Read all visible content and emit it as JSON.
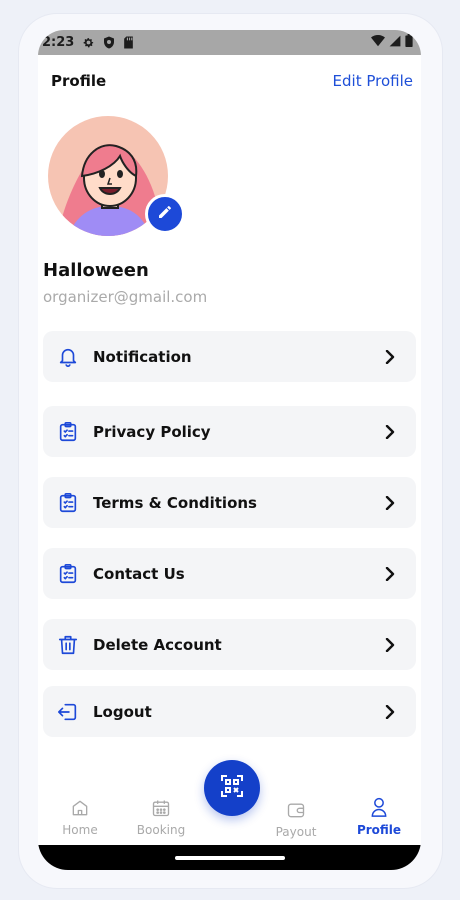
{
  "status_bar": {
    "time": "2:23"
  },
  "header": {
    "title": "Profile",
    "edit_label": "Edit Profile"
  },
  "user": {
    "name": "Halloween",
    "email": "organizer@gmail.com"
  },
  "menu": [
    {
      "label": "Notification",
      "icon": "bell-icon"
    },
    {
      "label": "Privacy Policy",
      "icon": "clipboard-list-icon"
    },
    {
      "label": "Terms & Conditions",
      "icon": "clipboard-list-icon"
    },
    {
      "label": "Contact Us",
      "icon": "clipboard-list-icon"
    },
    {
      "label": "Delete Account",
      "icon": "trash-icon"
    },
    {
      "label": "Logout",
      "icon": "logout-icon"
    }
  ],
  "nav": {
    "items": [
      {
        "label": "Home",
        "icon": "home-icon",
        "active": false
      },
      {
        "label": "Booking",
        "icon": "calendar-icon",
        "active": false
      },
      {
        "label": "Payout",
        "icon": "wallet-icon",
        "active": false
      },
      {
        "label": "Profile",
        "icon": "user-icon",
        "active": true
      }
    ],
    "center_button_icon": "qr-scan-icon"
  },
  "colors": {
    "accent": "#1d49d8",
    "menu_bg": "#f4f5f7",
    "muted": "#aaaaaa"
  }
}
